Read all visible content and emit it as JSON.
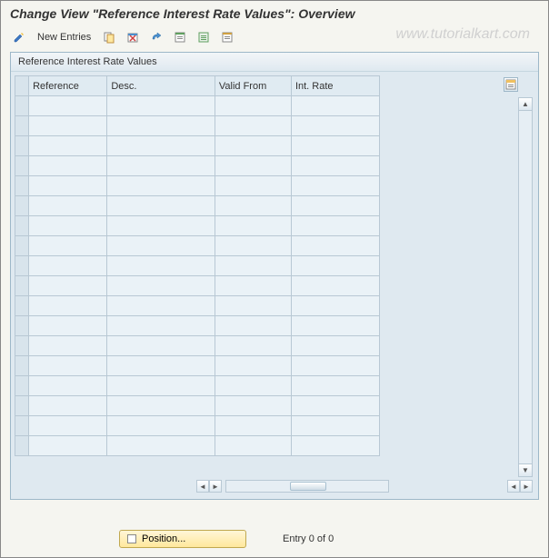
{
  "title": "Change View \"Reference Interest Rate Values\": Overview",
  "toolbar": {
    "new_entries": "New Entries"
  },
  "watermark": "www.tutorialkart.com",
  "panel": {
    "title": "Reference Interest Rate Values"
  },
  "columns": {
    "c1": "Reference",
    "c2": "Desc.",
    "c3": "Valid From",
    "c4": "Int. Rate"
  },
  "footer": {
    "position": "Position...",
    "entry_status": "Entry 0 of 0"
  }
}
